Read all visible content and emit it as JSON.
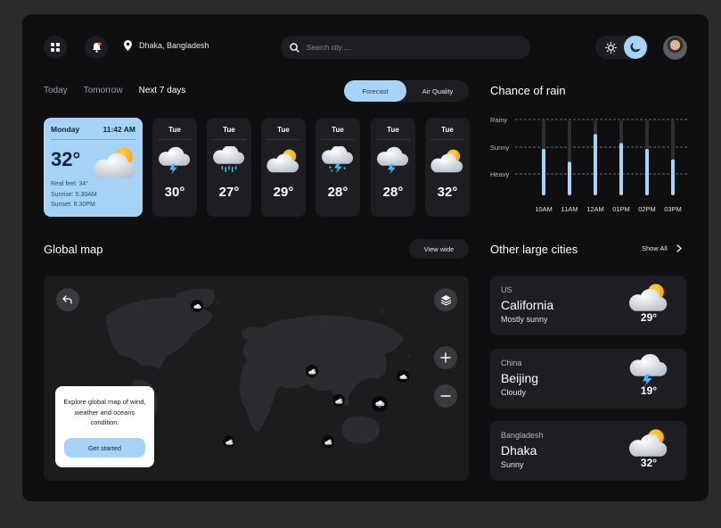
{
  "header": {
    "location": "Dhaka, Bangladesh",
    "search_placeholder": "Search city.....",
    "icons": [
      "grid-icon",
      "bell-icon",
      "location-pin-icon",
      "search-icon",
      "sun-icon",
      "moon-icon"
    ]
  },
  "tabs": {
    "today": "Today",
    "tomorrow": "Tomorrow",
    "next7": "Next 7 days"
  },
  "toggle": {
    "forecast": "Forecast",
    "air_quality": "Air Quality"
  },
  "today_card": {
    "day": "Monday",
    "time": "11:42 AM",
    "temp": "32°",
    "real_feel": "Real feel: 34°",
    "sunrise": "Sunrise: 5:30AM",
    "sunset": "Sunset: 6:30PM"
  },
  "forecast": [
    {
      "day": "Tue",
      "temp": "30°",
      "icon": "thunder-cloud-icon"
    },
    {
      "day": "Tue",
      "temp": "27°",
      "icon": "rain-cloud-icon"
    },
    {
      "day": "Tue",
      "temp": "29°",
      "icon": "sun-cloud-icon"
    },
    {
      "day": "Tue",
      "temp": "28°",
      "icon": "snow-thunder-cloud-icon"
    },
    {
      "day": "Tue",
      "temp": "28°",
      "icon": "thunder-cloud-icon"
    },
    {
      "day": "Tue",
      "temp": "32°",
      "icon": "sun-cloud-icon"
    }
  ],
  "rain": {
    "title": "Chance of rain",
    "levels": [
      "Rainy",
      "Sunny",
      "Heavy"
    ],
    "times": [
      "10AM",
      "11AM",
      "12AM",
      "01PM",
      "02PM",
      "03PM"
    ]
  },
  "chart_data": {
    "type": "bar",
    "title": "Chance of rain",
    "categories": [
      "10AM",
      "11AM",
      "12AM",
      "01PM",
      "02PM",
      "03PM"
    ],
    "values": [
      0.62,
      0.45,
      0.82,
      0.7,
      0.62,
      0.48
    ],
    "ylabel": "",
    "y_levels": [
      "Rainy",
      "Sunny",
      "Heavy"
    ],
    "grid": true,
    "colors": {
      "bar": "#a7d3f6",
      "track": "#2f2f33"
    }
  },
  "map": {
    "title": "Global map",
    "view_wide": "View wide",
    "explore_text": "Explore global map of wind, weather and oceans condition.",
    "get_started": "Get started"
  },
  "cities": {
    "title": "Other large cities",
    "show_all": "Show All",
    "items": [
      {
        "country": "US",
        "name": "California",
        "condition": "Mostly sunny",
        "temp": "29°",
        "icon": "sun-cloud-icon"
      },
      {
        "country": "China",
        "name": "Beijing",
        "condition": "Cloudy",
        "temp": "19°",
        "icon": "thunder-cloud-icon"
      },
      {
        "country": "Bangladesh",
        "name": "Dhaka",
        "condition": "Sunny",
        "temp": "32°",
        "icon": "sun-cloud-icon"
      }
    ]
  },
  "colors": {
    "accent": "#a7d3f6",
    "panel": "#0f0f12",
    "card": "#1e1e22",
    "page": "#2b2b2d"
  }
}
